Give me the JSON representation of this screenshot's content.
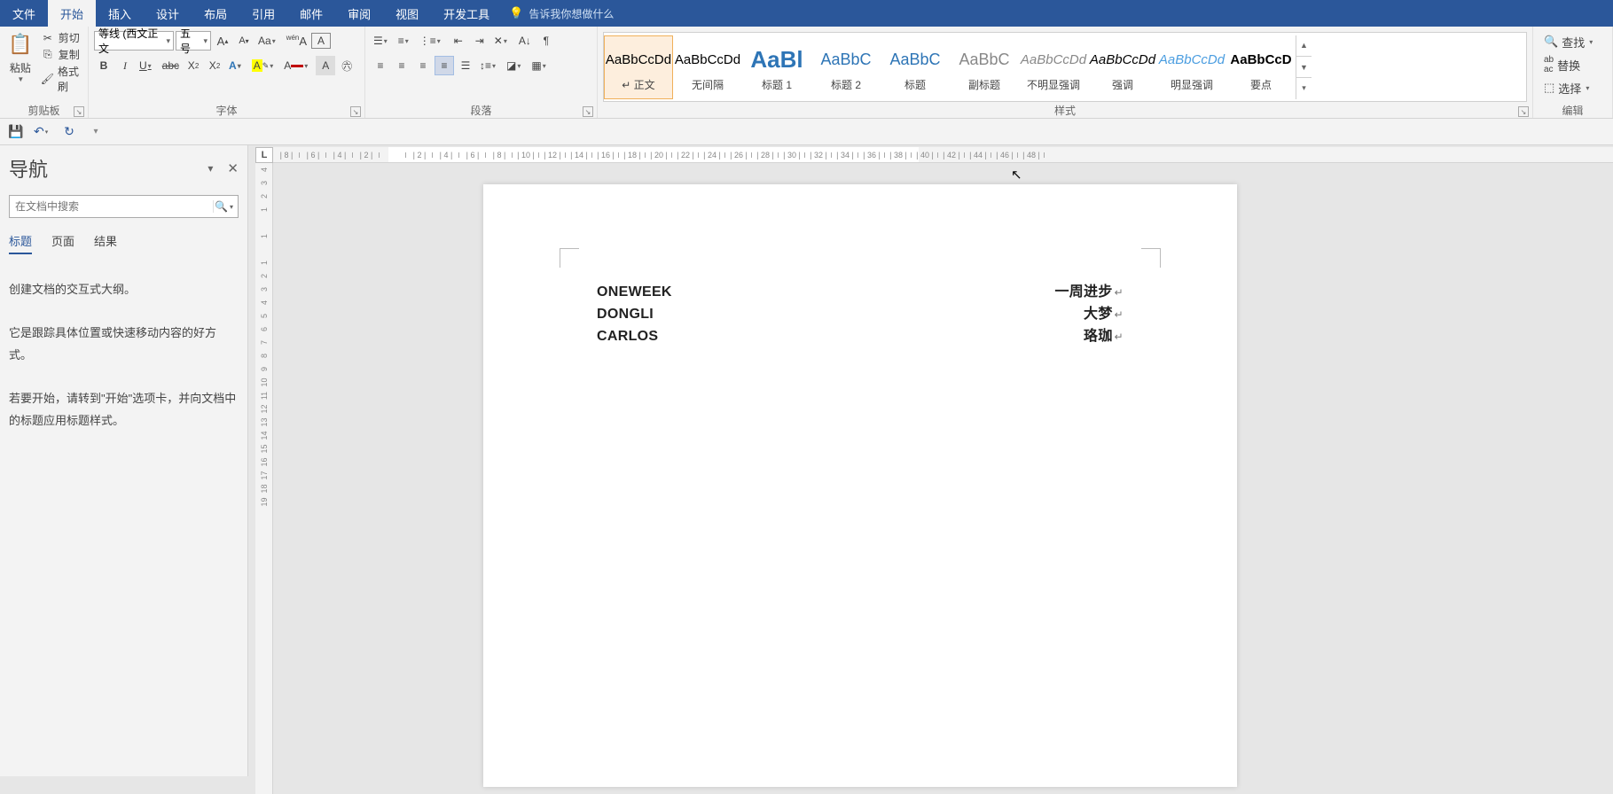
{
  "tabs": {
    "file": "文件",
    "home": "开始",
    "insert": "插入",
    "design": "设计",
    "layout": "布局",
    "references": "引用",
    "mailings": "邮件",
    "review": "审阅",
    "view": "视图",
    "developer": "开发工具",
    "tellme": "告诉我你想做什么"
  },
  "clipboard": {
    "paste": "粘贴",
    "cut": "剪切",
    "copy": "复制",
    "format_painter": "格式刷",
    "group": "剪贴板"
  },
  "font": {
    "name": "等线 (西文正文",
    "size": "五号",
    "group": "字体"
  },
  "paragraph": {
    "group": "段落"
  },
  "styles": {
    "group": "样式",
    "items": [
      {
        "preview": "AaBbCcDd",
        "name": "正文",
        "cls": ""
      },
      {
        "preview": "AaBbCcDd",
        "name": "无间隔",
        "cls": ""
      },
      {
        "preview": "AaBl",
        "name": "标题 1",
        "cls": "big"
      },
      {
        "preview": "AaBbC",
        "name": "标题 2",
        "cls": "med"
      },
      {
        "preview": "AaBbC",
        "name": "标题",
        "cls": "med"
      },
      {
        "preview": "AaBbC",
        "name": "副标题",
        "cls": "med gray"
      },
      {
        "preview": "AaBbCcDd",
        "name": "不明显强调",
        "cls": "ital gray"
      },
      {
        "preview": "AaBbCcDd",
        "name": "强调",
        "cls": "ital"
      },
      {
        "preview": "AaBbCcDd",
        "name": "明显强调",
        "cls": "ital blue"
      },
      {
        "preview": "AaBbCcD",
        "name": "要点",
        "cls": "bold"
      }
    ]
  },
  "editing": {
    "find": "查找",
    "replace": "替换",
    "select": "选择",
    "group": "编辑"
  },
  "nav": {
    "title": "导航",
    "search_placeholder": "在文档中搜索",
    "tab_headings": "标题",
    "tab_pages": "页面",
    "tab_results": "结果",
    "tip1": "创建文档的交互式大纲。",
    "tip2": "它是跟踪具体位置或快速移动内容的好方式。",
    "tip3": "若要开始，请转到\"开始\"选项卡，并向文档中的标题应用标题样式。"
  },
  "document": {
    "rows": [
      {
        "left": "ONEWEEK",
        "right": "一周进步"
      },
      {
        "left": "DONGLI",
        "right": "大梦"
      },
      {
        "left": "CARLOS",
        "right": "珞珈"
      }
    ]
  },
  "ruler": {
    "tab_mode": "L",
    "h_marks": [
      "8",
      "6",
      "4",
      "2",
      "",
      "2",
      "4",
      "6",
      "8",
      "10",
      "12",
      "14",
      "16",
      "18",
      "20",
      "22",
      "24",
      "26",
      "28",
      "30",
      "32",
      "34",
      "36",
      "38",
      "40",
      "42",
      "44",
      "46",
      "48"
    ],
    "v_marks": [
      "4",
      "3",
      "2",
      "1",
      "",
      "1",
      "",
      "1",
      "2",
      "3",
      "4",
      "5",
      "6",
      "7",
      "8",
      "9",
      "10",
      "11",
      "12",
      "13",
      "14",
      "15",
      "16",
      "17",
      "18",
      "19"
    ]
  }
}
